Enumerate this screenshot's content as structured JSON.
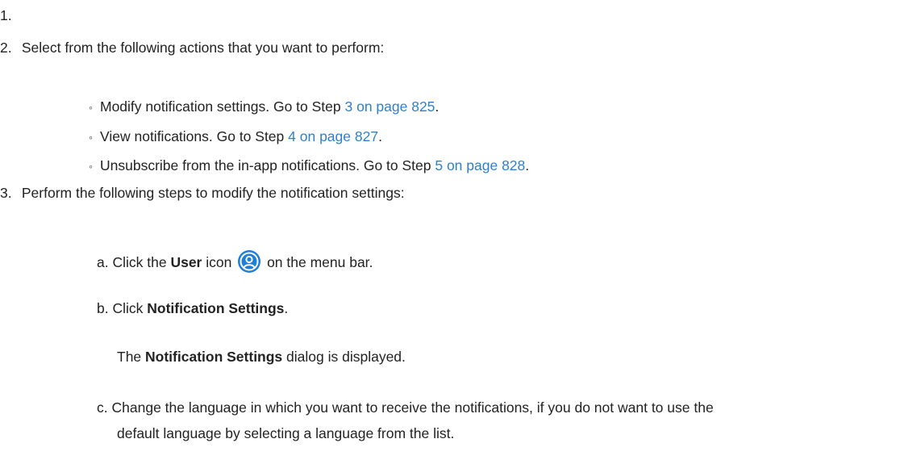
{
  "steps": {
    "s1": {
      "number": "1."
    },
    "s2": {
      "number": "2.",
      "text": "Select from the following actions that you want to perform:",
      "bullets": [
        {
          "text": "Modify notification settings. Go to Step ",
          "link": "3 on page 825",
          "end": "."
        },
        {
          "text": "View notifications. Go to Step ",
          "link": "4 on page 827",
          "end": "."
        },
        {
          "text": "Unsubscribe from the in-app notifications. Go to Step ",
          "link": "5 on page 828",
          "end": "."
        }
      ]
    },
    "s3": {
      "number": "3.",
      "text": "Perform the following steps to modify the notification settings:",
      "a": {
        "label": "a.",
        "pre": "Click the ",
        "bold": "User",
        "mid": " icon ",
        "post": " on the menu bar."
      },
      "b": {
        "label": "b.",
        "pre": "Click ",
        "bold": "Notification Settings",
        "post": "."
      },
      "b_result": {
        "pre": "The ",
        "bold": "Notification Settings",
        "post": " dialog is displayed."
      },
      "c": {
        "label": "c.",
        "line1": "Change the language in which you want to receive the notifications, if you do not want to use the",
        "line2": "default language by selecting a language from the list."
      }
    }
  },
  "colors": {
    "link": "#2e7fd0",
    "icon": "#1e7fd9"
  }
}
